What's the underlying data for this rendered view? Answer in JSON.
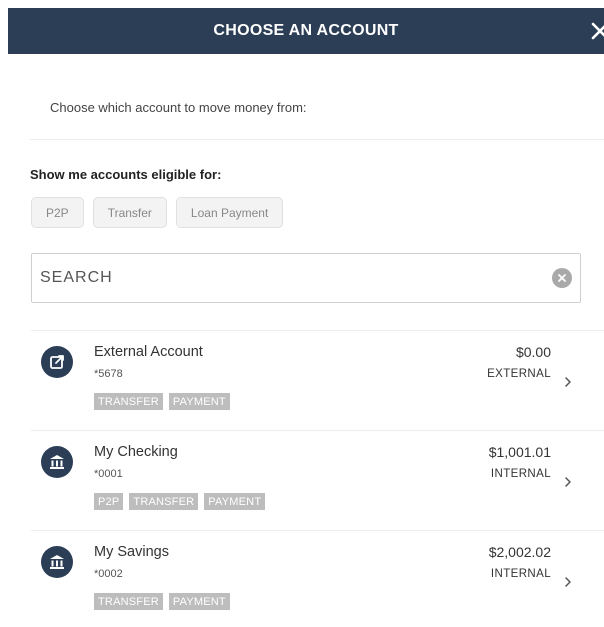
{
  "header": {
    "title": "CHOOSE AN ACCOUNT"
  },
  "instruction": "Choose which account to move money from:",
  "filter": {
    "title": "Show me accounts eligible for:",
    "chips": [
      "P2P",
      "Transfer",
      "Loan Payment"
    ]
  },
  "search": {
    "placeholder": "SEARCH"
  },
  "accounts": [
    {
      "icon": "external-link-icon",
      "name": "External Account",
      "number": "*5678",
      "tags": [
        "TRANSFER",
        "PAYMENT"
      ],
      "amount": "$0.00",
      "type": "EXTERNAL"
    },
    {
      "icon": "bank-icon",
      "name": "My Checking",
      "number": "*0001",
      "tags": [
        "P2P",
        "TRANSFER",
        "PAYMENT"
      ],
      "amount": "$1,001.01",
      "type": "INTERNAL"
    },
    {
      "icon": "bank-icon",
      "name": "My Savings",
      "number": "*0002",
      "tags": [
        "TRANSFER",
        "PAYMENT"
      ],
      "amount": "$2,002.02",
      "type": "INTERNAL"
    }
  ],
  "colors": {
    "header_bg": "#2c3e56",
    "icon_bg": "#2c3e56",
    "tag_bg": "#bdbdbd"
  }
}
